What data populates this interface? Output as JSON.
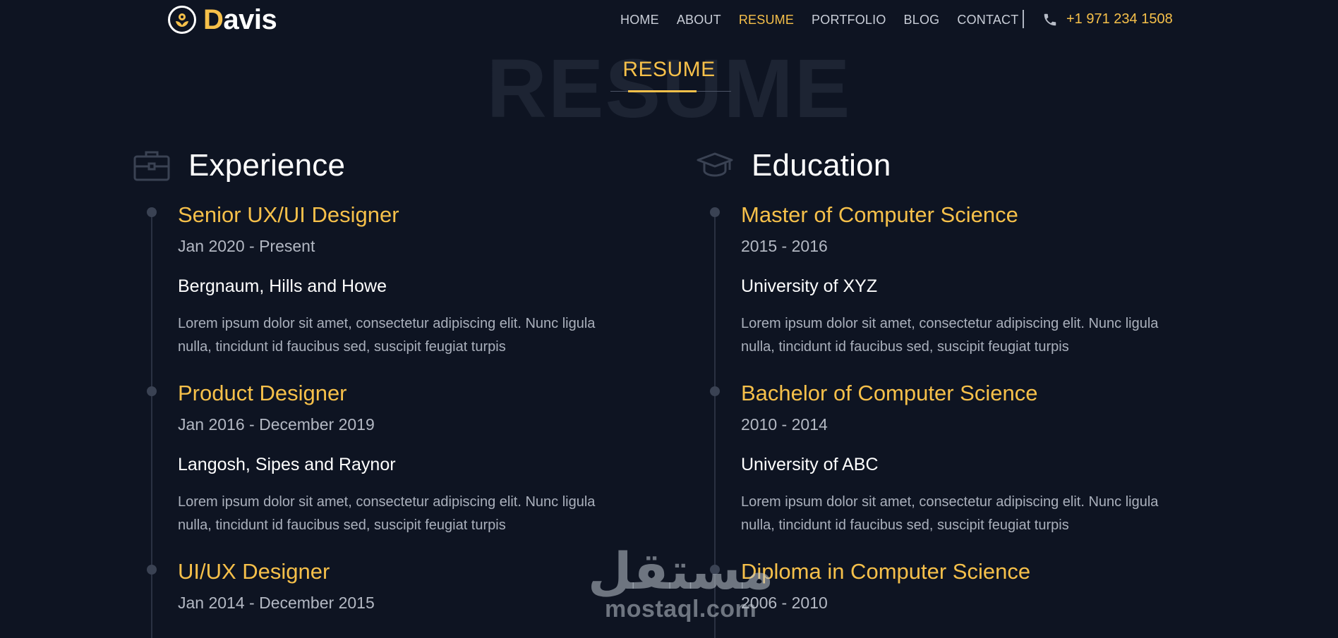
{
  "brand": {
    "initial": "D",
    "rest": "avis"
  },
  "nav": {
    "items": [
      {
        "label": "HOME",
        "active": false
      },
      {
        "label": "ABOUT",
        "active": false
      },
      {
        "label": "RESUME",
        "active": true
      },
      {
        "label": "PORTFOLIO",
        "active": false
      },
      {
        "label": "BLOG",
        "active": false
      },
      {
        "label": "CONTACT",
        "active": false
      }
    ],
    "phone": "+1 971 234 1508"
  },
  "section": {
    "background_text": "RESUME",
    "title": "RESUME"
  },
  "experience": {
    "heading": "Experience",
    "icon": "briefcase-icon",
    "items": [
      {
        "title": "Senior UX/UI Designer",
        "date": "Jan 2020 - Present",
        "org": "Bergnaum, Hills and Howe",
        "desc_line1": "Lorem ipsum dolor sit amet, consectetur adipiscing elit. Nunc ligula",
        "desc_line2": "nulla, tincidunt id faucibus sed, suscipit feugiat turpis"
      },
      {
        "title": "Product Designer",
        "date": "Jan 2016 - December 2019",
        "org": "Langosh, Sipes and Raynor",
        "desc_line1": "Lorem ipsum dolor sit amet, consectetur adipiscing elit. Nunc ligula",
        "desc_line2": "nulla, tincidunt id faucibus sed, suscipit feugiat turpis"
      },
      {
        "title": "UI/UX Designer",
        "date": "Jan 2014 - December 2015"
      }
    ]
  },
  "education": {
    "heading": "Education",
    "icon": "graduation-cap-icon",
    "items": [
      {
        "title": "Master of Computer Science",
        "date": "2015 - 2016",
        "org": "University of XYZ",
        "desc_line1": "Lorem ipsum dolor sit amet, consectetur adipiscing elit. Nunc ligula",
        "desc_line2": "nulla, tincidunt id faucibus sed, suscipit feugiat turpis"
      },
      {
        "title": "Bachelor of Computer Science",
        "date": "2010 - 2014",
        "org": "University of ABC",
        "desc_line1": "Lorem ipsum dolor sit amet, consectetur adipiscing elit. Nunc ligula",
        "desc_line2": "nulla, tincidunt id faucibus sed, suscipit feugiat turpis"
      },
      {
        "title": "Diploma in Computer Science",
        "date": "2006 - 2010"
      }
    ]
  },
  "watermark": {
    "arabic": "مستقل",
    "latin": "mostaql.com"
  },
  "colors": {
    "background": "#0e1422",
    "accent": "#f6c04a",
    "text": "#ffffff",
    "muted": "#aab0bc"
  }
}
